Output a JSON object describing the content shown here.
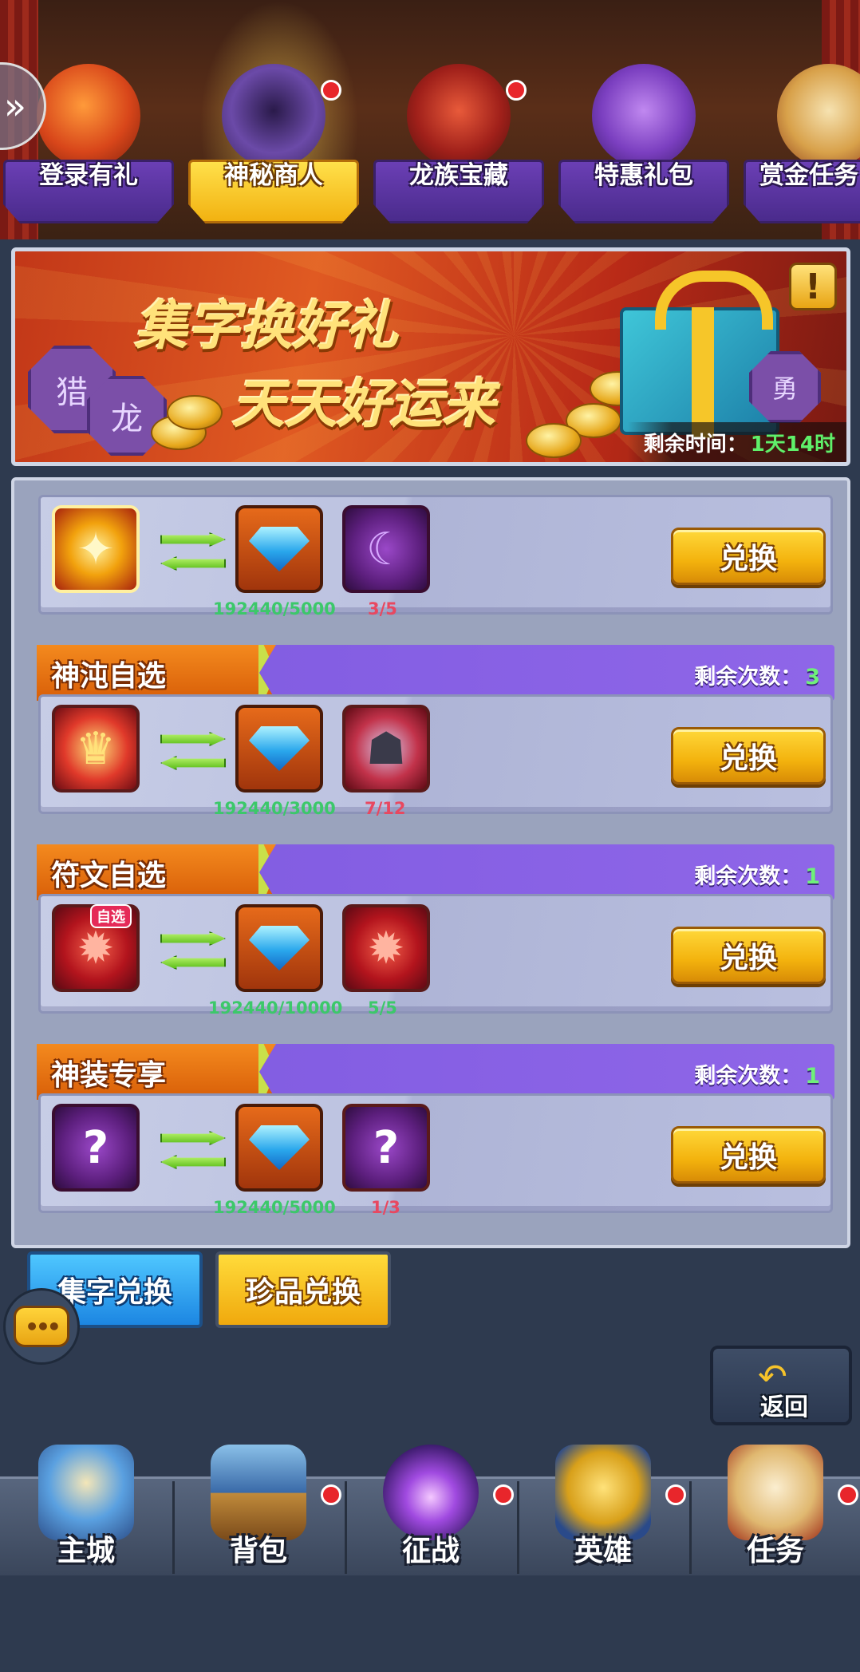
{
  "top_tabs": [
    {
      "label": "登录有礼",
      "icon": "gift-box-icon",
      "active": false,
      "has_dot": false
    },
    {
      "label": "神秘商人",
      "icon": "hooded-merchant-icon",
      "active": true,
      "has_dot": true
    },
    {
      "label": "龙族宝藏",
      "icon": "dragon-treasure-icon",
      "active": false,
      "has_dot": true
    },
    {
      "label": "特惠礼包",
      "icon": "purple-bag-icon",
      "active": false,
      "has_dot": false
    },
    {
      "label": "赏金任务",
      "icon": "scroll-icon",
      "active": false,
      "has_dot": false
    }
  ],
  "banner": {
    "title_line1": "集字换好礼",
    "title_line2": "天天好运来",
    "seal_1": "猎",
    "seal_2": "龙",
    "seal_3": "勇",
    "timer_label": "剩余时间：",
    "timer_value": "1天14时",
    "info_icon": "exclamation-icon"
  },
  "exchanges": [
    {
      "section_title": "",
      "remaining_label": "",
      "remaining_value": "",
      "source_icon": "gold-medal-icon",
      "cost_icon": "diamond-icon",
      "reward_icon": "purple-moon-orb-icon",
      "cost_amount": "192440/5000",
      "reward_amount": "3/5",
      "button": "兑换"
    },
    {
      "section_title": "神沌自选",
      "remaining_label": "剩余次数：",
      "remaining_value": "3",
      "source_icon": "golden-winged-armor-icon",
      "cost_icon": "diamond-icon",
      "reward_icon": "dark-mech-armor-icon",
      "cost_amount": "192440/3000",
      "reward_amount": "7/12",
      "button": "兑换"
    },
    {
      "section_title": "符文自选",
      "remaining_label": "剩余次数：",
      "remaining_value": "1",
      "source_icon": "red-rune-gear-icon",
      "source_tag": "自选",
      "cost_icon": "diamond-icon",
      "reward_icon": "red-rune-gear-icon",
      "cost_amount": "192440/10000",
      "reward_amount": "5/5",
      "button": "兑换"
    },
    {
      "section_title": "神装专享",
      "remaining_label": "剩余次数：",
      "remaining_value": "1",
      "source_icon": "mystery-gear-icon",
      "cost_icon": "diamond-icon",
      "reward_icon": "mystery-gear-icon",
      "cost_amount": "192440/5000",
      "reward_amount": "1/3",
      "button": "兑换"
    }
  ],
  "sub_tabs": {
    "tab1": "集字兑换",
    "tab2": "珍品兑换"
  },
  "chat_icon": "chat-bubble-icon",
  "back_button": {
    "label": "返回",
    "icon": "back-arrow-icon"
  },
  "bottom_nav": [
    {
      "label": "主城",
      "icon": "castle-icon",
      "has_dot": false
    },
    {
      "label": "背包",
      "icon": "treasure-chest-icon",
      "has_dot": true
    },
    {
      "label": "征战",
      "icon": "dragon-portal-icon",
      "has_dot": true
    },
    {
      "label": "英雄",
      "icon": "golden-helmet-icon",
      "has_dot": true
    },
    {
      "label": "任务",
      "icon": "quest-scroll-icon",
      "has_dot": true
    }
  ],
  "colors": {
    "accent_purple": "#8f66e8",
    "button_yellow": "#f3b20d",
    "count_green": "#6ff07a",
    "shortage_red": "#e84860",
    "enough_green": "#3cc86a"
  }
}
